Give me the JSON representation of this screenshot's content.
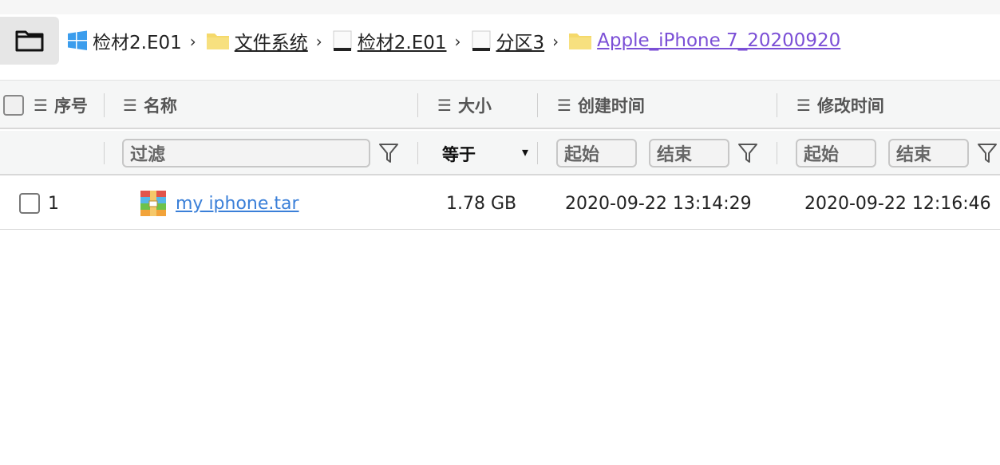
{
  "breadcrumb": {
    "items": [
      {
        "label": "检材2.E01",
        "icon": "windows-icon"
      },
      {
        "label": "文件系统",
        "icon": "folder-icon"
      },
      {
        "label": "检材2.E01",
        "icon": "disk-icon"
      },
      {
        "label": "分区3",
        "icon": "disk-icon"
      },
      {
        "label": "Apple_iPhone 7_20200920",
        "icon": "folder-icon"
      }
    ],
    "separator": "›"
  },
  "table": {
    "columns": {
      "index": "序号",
      "name": "名称",
      "size": "大小",
      "created": "创建时间",
      "modified": "修改时间"
    },
    "list_glyph": "☰",
    "filters": {
      "name_placeholder": "过滤",
      "size_operator": "等于",
      "size_arrow": "▾",
      "created_start": "起始",
      "created_end": "结束",
      "modified_start": "起始",
      "modified_end": "结束"
    },
    "rows": [
      {
        "index": "1",
        "name": "my iphone.tar",
        "icon": "archive-icon",
        "size": "1.78 GB",
        "created": "2020-09-22 13:14:29",
        "modified": "2020-09-22 12:16:46"
      }
    ]
  },
  "colors": {
    "link_current": "#7b4fd6",
    "link_file": "#3a7fd8",
    "folder": "#f5d96b",
    "windows": "#3b9ded"
  }
}
